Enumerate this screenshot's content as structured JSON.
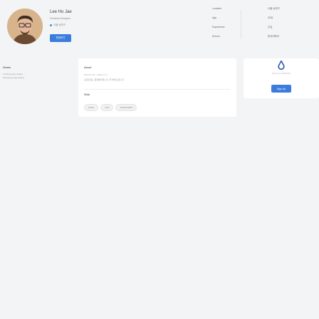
{
  "profile": {
    "name": "Lee Ho Jae",
    "role": "Frontend Designer",
    "location": "서울 송파구",
    "edit_label": "편집하기"
  },
  "info": {
    "labels": [
      "Location",
      "Age",
      "Experience",
      "School"
    ],
    "values": [
      "서울 송파구",
      "30세",
      "신입",
      "한국대학교"
    ]
  },
  "works": {
    "title": "Works",
    "items": [
      "Landing page design",
      "Shopping page desing"
    ]
  },
  "about": {
    "title": "About",
    "date": "2023.07.28 ~ 2023.11.17",
    "desc": "프론트엔드 웹개발자입니다. 잘 부탁드립니다.",
    "skills_title": "Skills",
    "skills": [
      "HTML",
      "CSS",
      "JAVASCRIPT"
    ]
  },
  "signup": {
    "text": "Find me at Wishket",
    "button_label": "Sign Up"
  },
  "colors": {
    "accent": "#3b7ddd",
    "background": "#f3f4f6"
  }
}
